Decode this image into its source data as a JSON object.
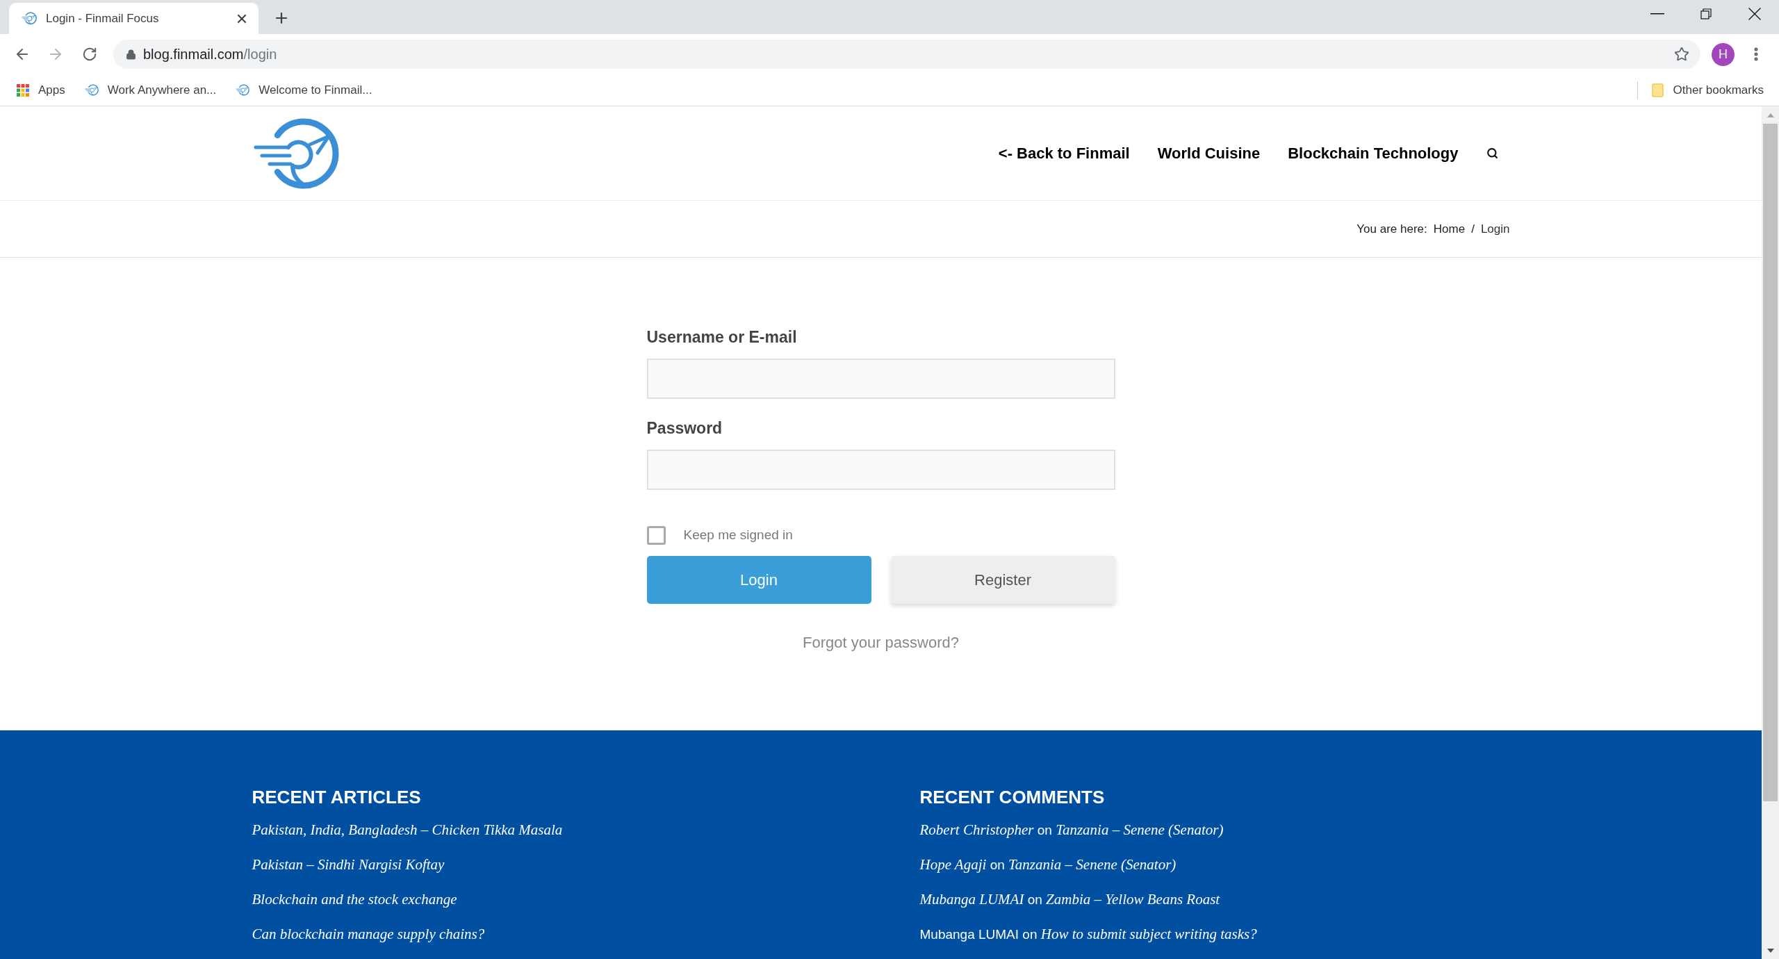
{
  "browser": {
    "tabs": [
      {
        "title": "Login - Finmail Focus",
        "selected": true
      }
    ],
    "address": {
      "host": "blog.finmail.com",
      "path": "/login"
    },
    "profile_initial": "H",
    "bookmarks": [
      {
        "kind": "apps",
        "label": "Apps"
      },
      {
        "kind": "site",
        "label": "Work Anywhere an..."
      },
      {
        "kind": "site",
        "label": "Welcome to Finmail..."
      }
    ],
    "other_bookmarks": "Other bookmarks"
  },
  "header": {
    "nav": [
      "<- Back to Finmail",
      "World Cuisine",
      "Blockchain Technology"
    ]
  },
  "breadcrumb": {
    "prefix": "You are here:",
    "items": [
      "Home",
      "Login"
    ],
    "separator": "/"
  },
  "login_form": {
    "fields": [
      {
        "label": "Username or E-mail"
      },
      {
        "label": "Password"
      }
    ],
    "remember": {
      "label": "Keep me signed in",
      "checked": false
    },
    "buttons": [
      {
        "kind": "primary",
        "label": "Login"
      },
      {
        "kind": "secondary",
        "label": "Register"
      }
    ],
    "forgot_link": "Forgot your password?"
  },
  "footer": {
    "recent_articles": {
      "title": "RECENT ARTICLES",
      "items": [
        "Pakistan, India, Bangladesh – Chicken Tikka Masala",
        "Pakistan – Sindhi Nargisi Koftay",
        "Blockchain and the stock exchange",
        "Can blockchain manage supply chains?"
      ]
    },
    "recent_comments": {
      "title": "RECENT COMMENTS",
      "items": [
        {
          "author": "Robert Christopher",
          "author_linked": true,
          "joiner": "on",
          "post": "Tanzania – Senene (Senator)"
        },
        {
          "author": "Hope Agaji",
          "author_linked": true,
          "joiner": "on",
          "post": "Tanzania – Senene (Senator)"
        },
        {
          "author": "Mubanga LUMAI",
          "author_linked": true,
          "joiner": "on",
          "post": "Zambia – Yellow Beans Roast"
        },
        {
          "author": "Mubanga LUMAI",
          "author_linked": false,
          "joiner": "on",
          "post": "How to submit subject writing tasks?"
        }
      ]
    }
  }
}
